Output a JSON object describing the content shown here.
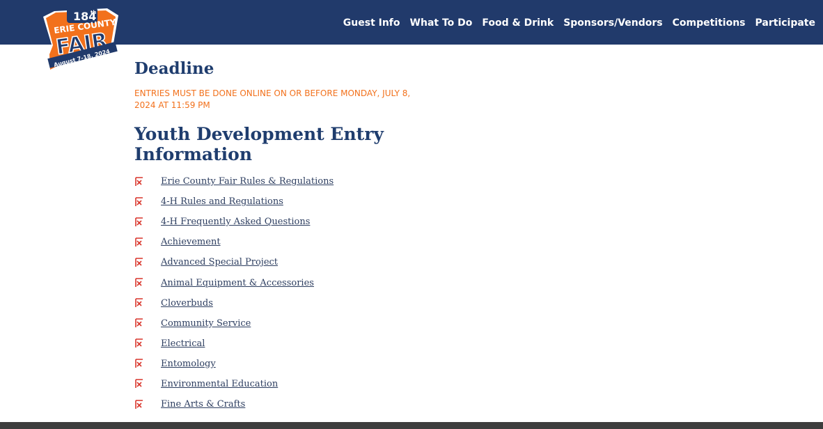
{
  "nav": {
    "items": [
      {
        "label": "Guest Info"
      },
      {
        "label": "What To Do"
      },
      {
        "label": "Food & Drink"
      },
      {
        "label": "Sponsors/Vendors"
      },
      {
        "label": "Competitions"
      },
      {
        "label": "Participate"
      }
    ]
  },
  "logo": {
    "number": "184",
    "suffix": "th",
    "county": "ERIE COUNTY",
    "fair": "FAIR",
    "dates": "August 7-18, 2024"
  },
  "main": {
    "deadline_heading": "Deadline",
    "deadline_text": "ENTRIES MUST BE DONE ONLINE ON OR BEFORE MONDAY, JULY 8, 2024 AT 11:59 PM",
    "section_heading": "Youth Development Entry Information",
    "documents": [
      {
        "label": "Erie County Fair Rules & Regulations",
        "icon": "pdf-icon"
      },
      {
        "label": "4-H Rules and Regulations",
        "icon": "pdf-icon"
      },
      {
        "label": "4-H Frequently Asked Questions",
        "icon": "pdf-icon"
      },
      {
        "label": "Achievement",
        "icon": "pdf-icon"
      },
      {
        "label": "Advanced Special Project",
        "icon": "pdf-icon"
      },
      {
        "label": "Animal Equipment & Accessories",
        "icon": "pdf-icon"
      },
      {
        "label": "Cloverbuds",
        "icon": "pdf-icon"
      },
      {
        "label": "Community Service",
        "icon": "pdf-icon"
      },
      {
        "label": "Electrical",
        "icon": "pdf-icon"
      },
      {
        "label": "Entomology",
        "icon": "pdf-icon"
      },
      {
        "label": "Environmental Education",
        "icon": "pdf-icon"
      },
      {
        "label": "Fine Arts & Crafts",
        "icon": "pdf-icon"
      }
    ]
  },
  "colors": {
    "header_bg": "#213a6b",
    "heading": "#1f3d6e",
    "deadline_orange": "#f2711c",
    "pdf_red": "#d9352b",
    "footer_bg": "#3d3d3d"
  }
}
